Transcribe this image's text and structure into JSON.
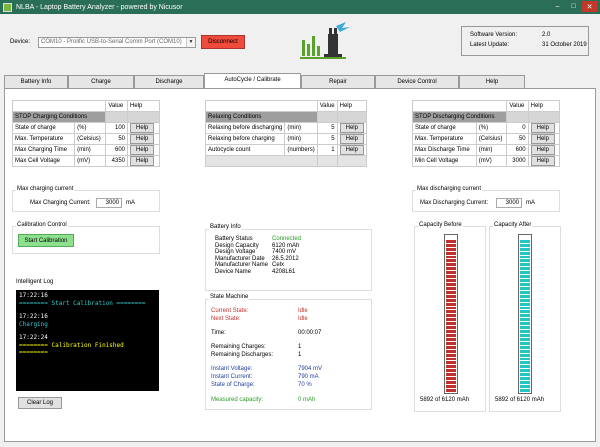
{
  "window": {
    "title": "NLBA - Laptop Battery Analyzer - powered by Nicusor",
    "minimize": "–",
    "maximize": "□",
    "close": "✕"
  },
  "device": {
    "label": "Device:",
    "value": "COM10 - Prolific USB-to-Serial Comm Port (COM10)",
    "disconnect": "Disconnect"
  },
  "version": {
    "software_label": "Software Version:",
    "software_value": "2.0",
    "update_label": "Latest Update:",
    "update_value": "31 October 2019"
  },
  "tabs": [
    {
      "label": "Battery Info"
    },
    {
      "label": "Charge"
    },
    {
      "label": "Discharge"
    },
    {
      "label": "AutoCycle / Calibrate"
    },
    {
      "label": "Repair"
    },
    {
      "label": "Device Control"
    },
    {
      "label": "Help"
    }
  ],
  "charging_grid": {
    "col_value": "Value",
    "col_help": "Help",
    "section": "STOP Charging Conditions",
    "rows": [
      {
        "name": "State of charge",
        "unit": "(%)",
        "value": "100",
        "help": "Help"
      },
      {
        "name": "Max. Temperature",
        "unit": "(Celsius)",
        "value": "50",
        "help": "Help"
      },
      {
        "name": "Max Charging Time",
        "unit": "(min)",
        "value": "600",
        "help": "Help"
      },
      {
        "name": "Max Cell Voltage",
        "unit": "(mV)",
        "value": "4350",
        "help": "Help"
      }
    ]
  },
  "relax_grid": {
    "col_value": "Value",
    "col_help": "Help",
    "section": "Relaxing Conditions",
    "rows": [
      {
        "name": "Relaxing before discharging",
        "unit": "(min)",
        "value": "5",
        "help": "Help"
      },
      {
        "name": "Relaxing before charging",
        "unit": "(min)",
        "value": "5",
        "help": "Help"
      },
      {
        "name": "Autocycle count",
        "unit": "(numbers)",
        "value": "1",
        "help": "Help"
      }
    ]
  },
  "discharging_grid": {
    "col_value": "Value",
    "col_help": "Help",
    "section": "STOP Discharging Conditions",
    "rows": [
      {
        "name": "State of charge",
        "unit": "(%)",
        "value": "0",
        "help": "Help"
      },
      {
        "name": "Max. Temperature",
        "unit": "(Celsius)",
        "value": "50",
        "help": "Help"
      },
      {
        "name": "Max Discharge Time",
        "unit": "(min)",
        "value": "600",
        "help": "Help"
      },
      {
        "name": "Min Cell Voltage",
        "unit": "(mV)",
        "value": "3000",
        "help": "Help"
      }
    ]
  },
  "max_charge": {
    "title": "Max charging current",
    "label": "Max Charging Current:",
    "value": "3000",
    "unit": "mA"
  },
  "max_discharge": {
    "title": "Max discharging current",
    "label": "Max Discharging Current:",
    "value": "3000",
    "unit": "mA"
  },
  "calibration": {
    "title": "Calibration Control",
    "start": "Start Calibration"
  },
  "log": {
    "title": "Intelligent Log",
    "lines": [
      {
        "time": "17:22:16",
        "text": "======== Start Calibration ========"
      },
      {
        "time": "17:22:16",
        "text": "Charging"
      },
      {
        "time": "17:22:24",
        "text": "======== Calibration Finished ========"
      }
    ],
    "clear": "Clear Log"
  },
  "battery_info": {
    "title": "Battery Info",
    "rows": [
      {
        "k": "Battery Status",
        "v": "Connected"
      },
      {
        "k": "Design Capacity",
        "v": "6120 mAh"
      },
      {
        "k": "Design Voltage",
        "v": "7400 mV"
      },
      {
        "k": "Manufacturer Date",
        "v": "26.5.2012"
      },
      {
        "k": "Manufacturer Name",
        "v": "Celx"
      },
      {
        "k": "Device Name",
        "v": "4208L61"
      }
    ]
  },
  "state_machine": {
    "title": "State Machine",
    "current_label": "Current State:",
    "current_value": "Idle",
    "next_label": "Next State:",
    "next_value": "Idle",
    "time_label": "Time:",
    "time_value": "00:00:07",
    "rem_charges_label": "Remaining Charges:",
    "rem_charges_value": "1",
    "rem_discharges_label": "Remaining Discharges:",
    "rem_discharges_value": "1",
    "voltage_label": "Instant Voltage:",
    "voltage_value": "7904 mV",
    "current_inst_label": "Instant Current:",
    "current_inst_value": "790 mA",
    "soc_label": "State of Charge:",
    "soc_value": "70 %",
    "measured_label": "Measured capacity:",
    "measured_value": "0 mAh"
  },
  "capacity": {
    "before_title": "Capacity Before",
    "before_value": "5892 of 6120 mAh",
    "before_fraction": 0.963,
    "after_title": "Capacity After",
    "after_value": "5892 of 6120 mAh",
    "after_fraction": 0.963
  },
  "colors": {
    "accent_title": "#2a6e57",
    "disconnect": "#f04a3a",
    "start": "#8ee08e",
    "bar_before": "#c0302f",
    "bar_after": "#1fc6c6",
    "connected": "#2a9a2a",
    "state_red": "#c0302f",
    "state_blue": "#2040a0",
    "measured_green": "#2a9a2a"
  },
  "icons": {
    "logo": "usb-plug-icon"
  }
}
